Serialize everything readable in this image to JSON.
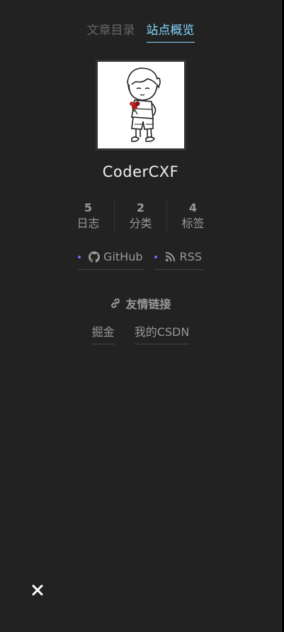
{
  "tabs": [
    {
      "label": "文章目录",
      "active": false
    },
    {
      "label": "站点概览",
      "active": true
    }
  ],
  "author": {
    "name": "CoderCXF"
  },
  "stats": [
    {
      "count": "5",
      "label": "日志"
    },
    {
      "count": "2",
      "label": "分类"
    },
    {
      "count": "4",
      "label": "标签"
    }
  ],
  "social": [
    {
      "label": "GitHub",
      "icon": "github-icon"
    },
    {
      "label": "RSS",
      "icon": "rss-icon"
    }
  ],
  "blogroll": {
    "title": "友情链接",
    "icon": "link-icon",
    "links": [
      "掘金",
      "我的CSDN"
    ]
  },
  "colors": {
    "background": "#222222",
    "accent": "#87daff",
    "dot": "#7a6cf5",
    "text": "#999999"
  }
}
